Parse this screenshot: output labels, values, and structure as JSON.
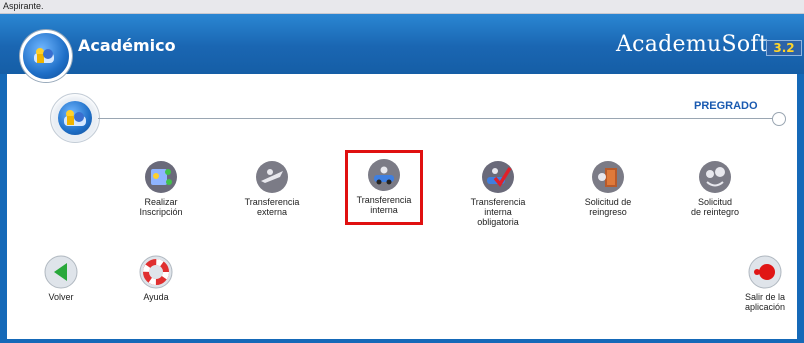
{
  "topbar": {
    "text": "Aspirante."
  },
  "header": {
    "title": "Académico",
    "brand": "AcademuSoft",
    "brand_version": "3.2"
  },
  "section": {
    "label": "PREGRADO"
  },
  "options": [
    {
      "label": "Realizar\nInscripción",
      "icon": "registration-icon"
    },
    {
      "label": "Transferencia\nexterna",
      "icon": "plane-icon"
    },
    {
      "label": "Transferencia\ninterna",
      "icon": "car-icon"
    },
    {
      "label": "Transferencia\ninterna\nobligatoria",
      "icon": "checkmark-car-icon"
    },
    {
      "label": "Solicitud de\nreingreso",
      "icon": "door-icon"
    },
    {
      "label": "Solicitud\nde reintegro",
      "icon": "faces-icon"
    }
  ],
  "footer": {
    "back_label": "Volver",
    "help_label": "Ayuda",
    "exit_label": "Salir de la\naplicación"
  },
  "colors": {
    "header": "#1a66b2",
    "accent": "#1a5ab0",
    "highlight": "#e01010"
  }
}
